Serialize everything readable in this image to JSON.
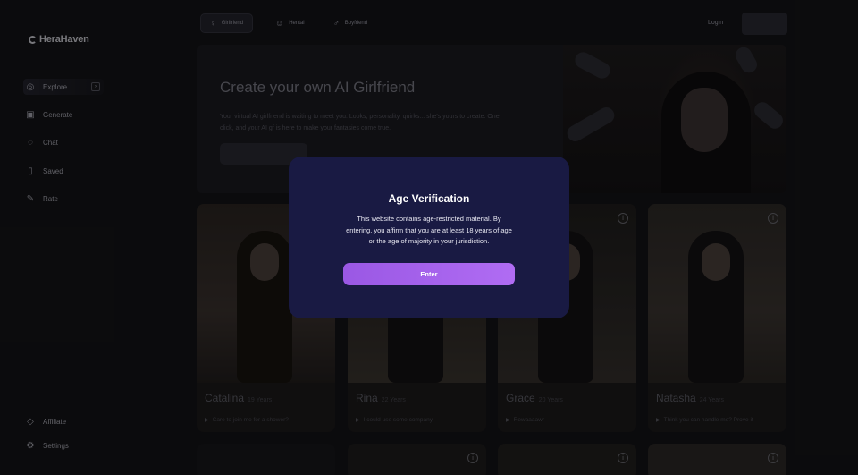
{
  "app": {
    "logo_text": "HeraHaven"
  },
  "sidebar": {
    "items": [
      {
        "label": "Explore",
        "icon": "compass-icon"
      },
      {
        "label": "Generate",
        "icon": "image-icon"
      },
      {
        "label": "Chat",
        "icon": "chat-icon"
      },
      {
        "label": "Saved",
        "icon": "bookmark-icon"
      },
      {
        "label": "Rate",
        "icon": "pencil-icon"
      }
    ],
    "footer": [
      {
        "label": "Affiliate",
        "icon": "diamond-icon"
      },
      {
        "label": "Settings",
        "icon": "gear-icon"
      }
    ]
  },
  "topbar": {
    "tabs": [
      {
        "label": "Girlfriend",
        "icon": "female-icon"
      },
      {
        "label": "Hentai",
        "icon": "anime-icon"
      },
      {
        "label": "Boyfriend",
        "icon": "male-icon"
      }
    ],
    "login_label": "Login"
  },
  "hero": {
    "title": "Create your own AI Girlfriend",
    "description": "Your virtual AI girlfriend is waiting to meet you. Looks, personality, quirks... she's yours to create. One click, and your AI gf is here to make your fantasies come true."
  },
  "cards": [
    {
      "name": "Catalina",
      "age": "19 Years",
      "message": "Care to join me for a shower?"
    },
    {
      "name": "Rina",
      "age": "22 Years",
      "message": "I could use some company"
    },
    {
      "name": "Grace",
      "age": "20 Years",
      "message": "Rewaaaawr"
    },
    {
      "name": "Natasha",
      "age": "24 Years",
      "message": "Think you can handle me? Prove it"
    }
  ],
  "modal": {
    "title": "Age Verification",
    "text": "This website contains age-restricted material. By entering, you affirm that you are at least 18 years of age or the age of majority in your jurisdiction.",
    "button_label": "Enter",
    "background_color": "#191a43",
    "accent_color": "#a562ec"
  }
}
